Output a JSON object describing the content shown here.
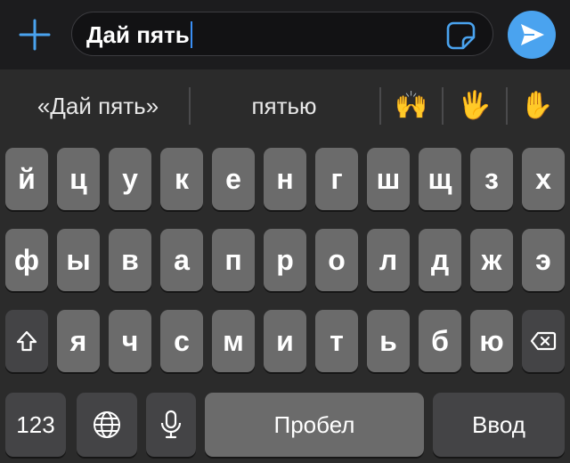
{
  "input": {
    "text": "Дай пять"
  },
  "suggestions": {
    "items": [
      "«Дай пять»",
      "пятью"
    ],
    "emoji": [
      "🙌",
      "🖐",
      "✋"
    ]
  },
  "keyboard": {
    "row1": [
      "й",
      "ц",
      "у",
      "к",
      "е",
      "н",
      "г",
      "ш",
      "щ",
      "з",
      "х"
    ],
    "row2": [
      "ф",
      "ы",
      "в",
      "а",
      "п",
      "р",
      "о",
      "л",
      "д",
      "ж",
      "э"
    ],
    "row3": [
      "я",
      "ч",
      "с",
      "м",
      "и",
      "т",
      "ь",
      "б",
      "ю"
    ],
    "numbers_label": "123",
    "space_label": "Пробел",
    "return_label": "Ввод"
  },
  "colors": {
    "accent": "#4aa3ef",
    "key_light": "#6b6b6b",
    "key_dark": "#444446",
    "background": "#2b2b2b"
  },
  "icons": {
    "add": "plus-icon",
    "sticker": "sticker-icon",
    "send": "send-icon",
    "shift": "shift-icon",
    "delete": "backspace-icon",
    "globe": "globe-icon",
    "mic": "microphone-icon"
  }
}
